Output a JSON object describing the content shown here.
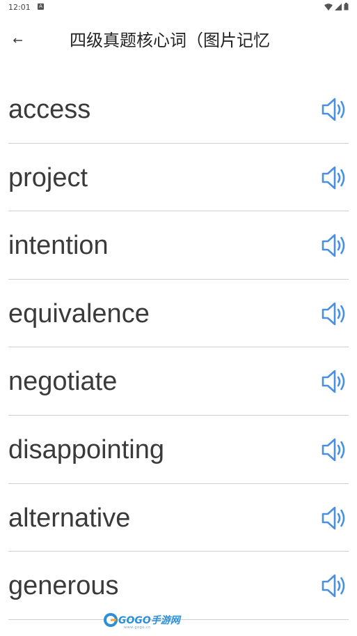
{
  "status_bar": {
    "time": "12:01",
    "notification_icon": "a-notification-icon",
    "icons": [
      "wifi-icon",
      "signal-icon",
      "battery-icon"
    ]
  },
  "header": {
    "back_icon": "back-arrow-icon",
    "title": "四级真题核心词（图片记忆"
  },
  "words": [
    {
      "word": "access",
      "speaker_icon": "speaker-icon"
    },
    {
      "word": "project",
      "speaker_icon": "speaker-icon"
    },
    {
      "word": "intention",
      "speaker_icon": "speaker-icon"
    },
    {
      "word": "equivalence",
      "speaker_icon": "speaker-icon"
    },
    {
      "word": "negotiate",
      "speaker_icon": "speaker-icon"
    },
    {
      "word": "disappointing",
      "speaker_icon": "speaker-icon"
    },
    {
      "word": "alternative",
      "speaker_icon": "speaker-icon"
    },
    {
      "word": "generous",
      "speaker_icon": "speaker-icon"
    }
  ],
  "watermark": {
    "brand": "GOGO手游网",
    "url": "www.gogo.cn"
  },
  "colors": {
    "speaker_blue": "#4a90e2",
    "divider": "#cfcfcf",
    "text": "#3a3a3a"
  }
}
